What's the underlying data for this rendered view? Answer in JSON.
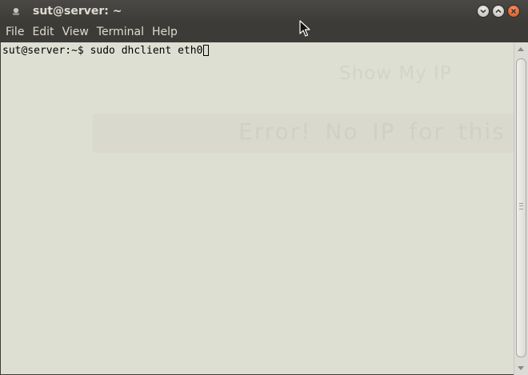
{
  "window": {
    "title": "sut@server: ~"
  },
  "menubar": {
    "items": [
      "File",
      "Edit",
      "View",
      "Terminal",
      "Help"
    ]
  },
  "terminal": {
    "prompt": "sut@server:~$ ",
    "command": "sudo dhclient eth0",
    "background_overlay": {
      "title": "Show My IP",
      "error": "Error! No IP for this ser"
    }
  },
  "colors": {
    "titlebar": "#3c3b37",
    "terminal_bg": "#dedfd3",
    "close_button": "#d84a12"
  },
  "icons": {
    "window_icon": "terminal-app-icon",
    "minimize": "minimize-icon",
    "maximize": "maximize-icon",
    "close": "close-icon",
    "pointer": "mouse-pointer-icon"
  }
}
